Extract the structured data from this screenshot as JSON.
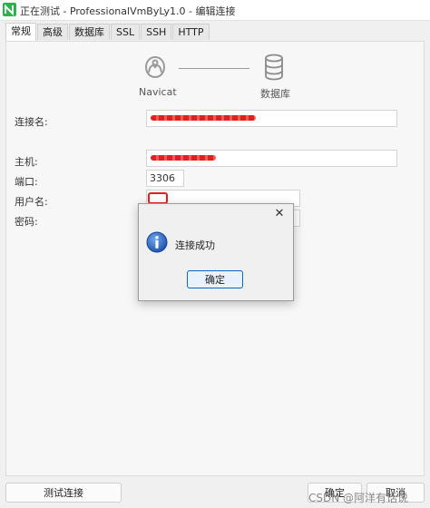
{
  "window": {
    "title": "正在测试 - ProfessionalVmByLy1.0 - 编辑连接"
  },
  "tabs": [
    {
      "label": "常规",
      "active": true
    },
    {
      "label": "高级",
      "active": false
    },
    {
      "label": "数据库",
      "active": false
    },
    {
      "label": "SSL",
      "active": false
    },
    {
      "label": "SSH",
      "active": false
    },
    {
      "label": "HTTP",
      "active": false
    }
  ],
  "diagram": {
    "left_label": "Navicat",
    "right_label": "数据库"
  },
  "form": {
    "connection_name_label": "连接名:",
    "host_label": "主机:",
    "port_label": "端口:",
    "port_value": "3306",
    "username_label": "用户名:",
    "password_label": "密码:"
  },
  "footer": {
    "test_button": "测试连接",
    "ok_button": "确定",
    "cancel_button": "取消"
  },
  "dialog": {
    "message": "连接成功",
    "ok_button": "确定",
    "close_glyph": "✕"
  },
  "watermark": "CSDN @阿洋有话说",
  "colors": {
    "accent": "#0a64c8",
    "brand_green": "#2bb24c",
    "redaction": "#e02020"
  }
}
